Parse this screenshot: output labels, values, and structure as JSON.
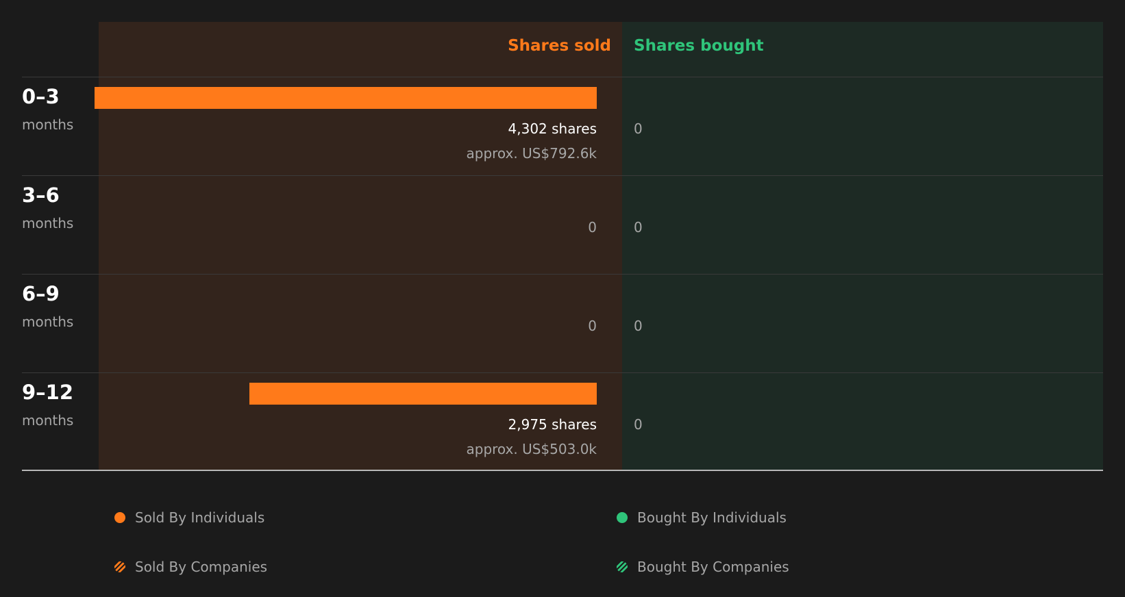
{
  "header": {
    "sold_label": "Shares sold",
    "bought_label": "Shares bought"
  },
  "colors": {
    "sold": "#ff7a1a",
    "bought": "#2fc47a",
    "sold_background": "#33241c",
    "bought_background": "#1d2a24"
  },
  "rows": [
    {
      "period": "0–3",
      "unit": "months",
      "sold_shares": "4,302 shares",
      "sold_value": "approx. US$792.6k",
      "sold_zero": "",
      "bought": "0"
    },
    {
      "period": "3–6",
      "unit": "months",
      "sold_shares": "",
      "sold_value": "",
      "sold_zero": "0",
      "bought": "0"
    },
    {
      "period": "6–9",
      "unit": "months",
      "sold_shares": "",
      "sold_value": "",
      "sold_zero": "0",
      "bought": "0"
    },
    {
      "period": "9–12",
      "unit": "months",
      "sold_shares": "2,975 shares",
      "sold_value": "approx. US$503.0k",
      "sold_zero": "",
      "bought": "0"
    }
  ],
  "legend": {
    "sold_individuals": "Sold By Individuals",
    "sold_companies": "Sold By Companies",
    "bought_individuals": "Bought By Individuals",
    "bought_companies": "Bought By Companies"
  },
  "chart_data": {
    "type": "bar",
    "orientation": "horizontal",
    "categories": [
      "0–3 months",
      "3–6 months",
      "6–9 months",
      "9–12 months"
    ],
    "series": [
      {
        "name": "Shares sold",
        "values": [
          4302,
          0,
          0,
          2975
        ]
      },
      {
        "name": "Shares bought",
        "values": [
          0,
          0,
          0,
          0
        ]
      }
    ],
    "sold_value_labels": [
      "approx. US$792.6k",
      "",
      "",
      "approx. US$503.0k"
    ],
    "legend_entries": [
      "Sold By Individuals",
      "Sold By Companies",
      "Bought By Individuals",
      "Bought By Companies"
    ],
    "legend_position": "bottom",
    "grid": false
  }
}
